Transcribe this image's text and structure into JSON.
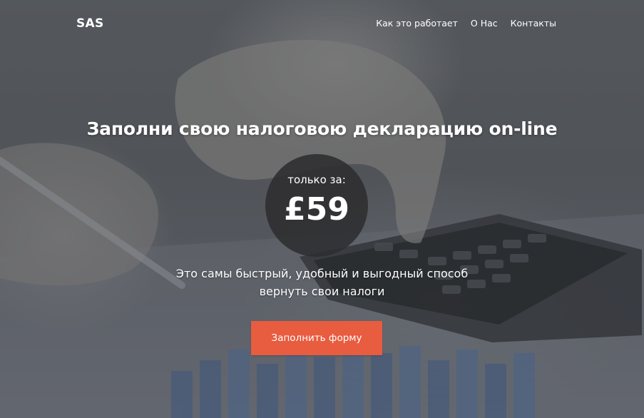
{
  "nav": {
    "logo": "SAS",
    "links": [
      {
        "label": "Как это работает"
      },
      {
        "label": "О Нас"
      },
      {
        "label": "Контакты"
      }
    ]
  },
  "hero": {
    "headline": "Заполни свою налоговою декларацию on-line",
    "price_caption": "только за:",
    "price_value": "£59",
    "subtitle_line1": "Это самы быстрый, удобный и выгодный способ",
    "subtitle_line2": "вернуть свои налоги",
    "cta_label": "Заполнить форму"
  },
  "colors": {
    "accent": "#e85c3f",
    "price_circle": "#2d2d30",
    "text": "#ffffff"
  },
  "background": {
    "description_icon": "photo-hand-calculator"
  }
}
